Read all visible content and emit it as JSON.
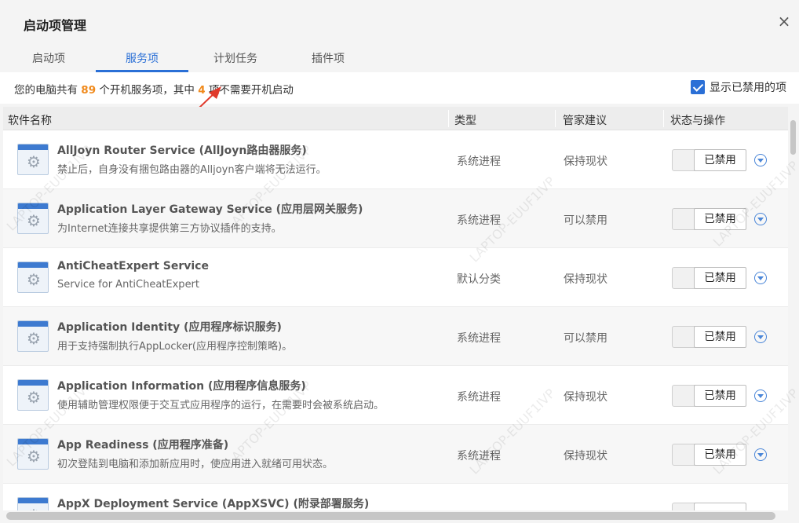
{
  "window": {
    "title": "启动项管理",
    "close_glyph": "×"
  },
  "tabs": [
    {
      "label": "启动项",
      "active": false
    },
    {
      "label": "服务项",
      "active": true
    },
    {
      "label": "计划任务",
      "active": false
    },
    {
      "label": "插件项",
      "active": false
    }
  ],
  "summary": {
    "prefix": "您的电脑共有",
    "total": "89",
    "middle": "个开机服务项，其中",
    "count": "4",
    "suffix": "项不需要开机启动"
  },
  "show_disabled": {
    "label": "显示已禁用的项",
    "checked": true
  },
  "table": {
    "headers": {
      "name": "软件名称",
      "type": "类型",
      "advice": "管家建议",
      "status": "状态与操作"
    },
    "rows": [
      {
        "name": "AllJoyn Router Service (AllJoyn路由器服务)",
        "desc": "禁止后，自身没有捆包路由器的Alljoyn客户端将无法运行。",
        "type": "系统进程",
        "advice": "保持现状",
        "status": "已禁用"
      },
      {
        "name": "Application Layer Gateway Service (应用层网关服务)",
        "desc": "为Internet连接共享提供第三方协议插件的支持。",
        "type": "系统进程",
        "advice": "可以禁用",
        "status": "已禁用"
      },
      {
        "name": "AntiCheatExpert Service",
        "desc": "Service for AntiCheatExpert",
        "type": "默认分类",
        "advice": "保持现状",
        "status": "已禁用"
      },
      {
        "name": "Application Identity (应用程序标识服务)",
        "desc": "用于支持强制执行AppLocker(应用程序控制策略)。",
        "type": "系统进程",
        "advice": "可以禁用",
        "status": "已禁用"
      },
      {
        "name": "Application Information (应用程序信息服务)",
        "desc": "使用辅助管理权限便于交互式应用程序的运行，在需要时会被系统启动。",
        "type": "系统进程",
        "advice": "保持现状",
        "status": "已禁用"
      },
      {
        "name": "App Readiness (应用程序准备)",
        "desc": "初次登陆到电脑和添加新应用时，使应用进入就绪可用状态。",
        "type": "系统进程",
        "advice": "保持现状",
        "status": "已禁用"
      },
      {
        "name": "AppX Deployment Service (AppXSVC) (附录部署服务)",
        "desc": "",
        "type": "",
        "advice": "",
        "status": ""
      }
    ]
  },
  "watermark": "LAPTOP-EUUF1IVP",
  "colors": {
    "accent": "#2a6fd6",
    "highlight_number": "#f08a1c",
    "annotation_arrow": "#e0392b"
  },
  "icons": {
    "service": "gear-window-icon",
    "expand": "chevron-down-circle-icon",
    "checkbox": "checkmark-icon",
    "close": "close-icon"
  }
}
